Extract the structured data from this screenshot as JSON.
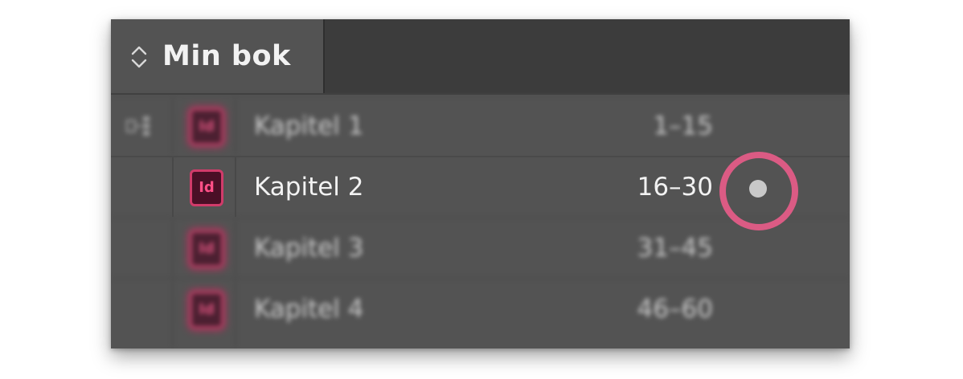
{
  "panel": {
    "tab_title": "Min bok",
    "colors": {
      "panel_bg": "#535353",
      "tabbar_bg": "#3c3c3c",
      "accent_pink": "#d13b6a",
      "highlight_ring": "#db5b84",
      "text": "#f2f2f2"
    }
  },
  "icons": {
    "tab": "chevron-up-down-icon",
    "document": "indesign-document-icon",
    "style_source": "style-source-icon",
    "status": "modified-status-dot-icon"
  },
  "documents": [
    {
      "name": "Kapitel 1",
      "pages": "1–15",
      "icon_label": "Id",
      "style_source": true,
      "status_dot": false,
      "focused": false
    },
    {
      "name": "Kapitel 2",
      "pages": "16–30",
      "icon_label": "Id",
      "style_source": false,
      "status_dot": true,
      "focused": true
    },
    {
      "name": "Kapitel 3",
      "pages": "31–45",
      "icon_label": "Id",
      "style_source": false,
      "status_dot": false,
      "focused": false
    },
    {
      "name": "Kapitel 4",
      "pages": "46–60",
      "icon_label": "Id",
      "style_source": false,
      "status_dot": false,
      "focused": false
    }
  ]
}
